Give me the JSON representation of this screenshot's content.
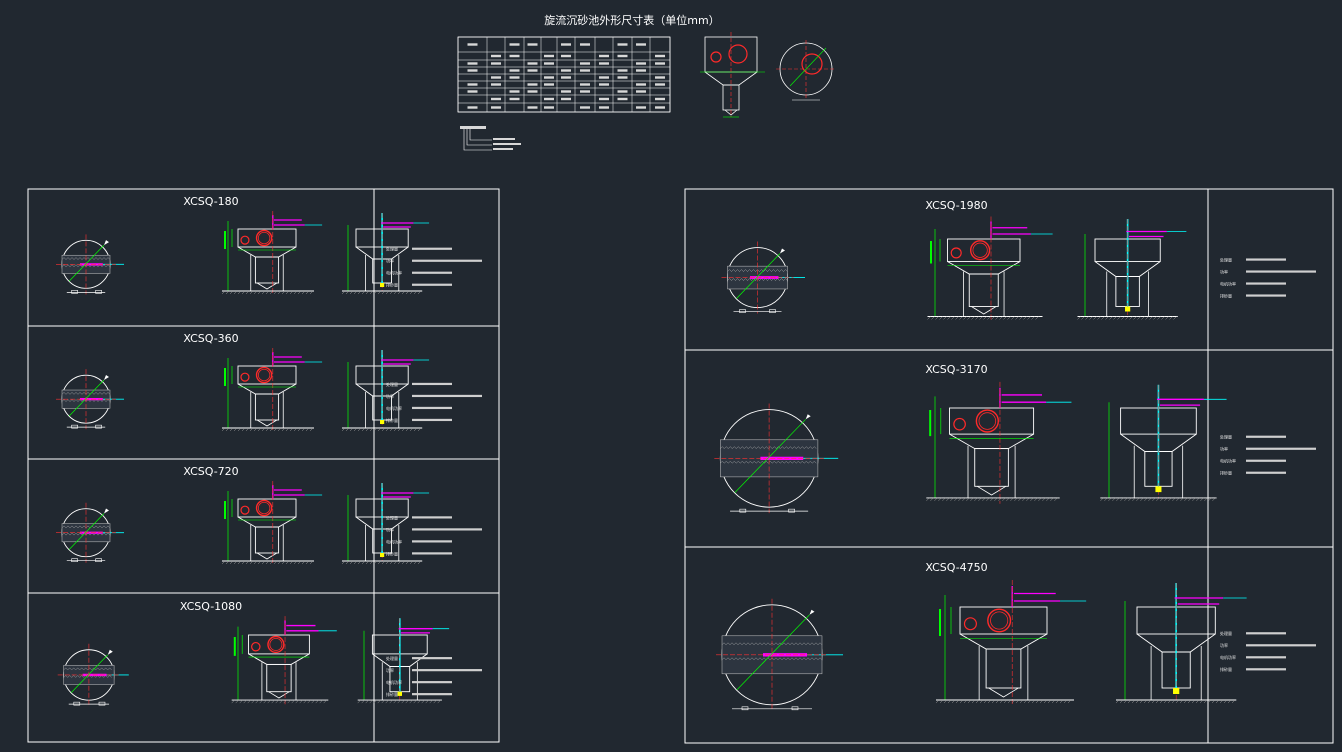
{
  "drawing": {
    "header_title": "旋流沉砂池外形尺寸表（单位mm）",
    "colors": {
      "background": "#212830",
      "frame": "#ffffff",
      "dimension": "#00ff00",
      "pipe": "#ff2a2a",
      "center": "#ff3030",
      "magenta": "#ff00ff",
      "cyan": "#00ffff",
      "yellow": "#ffff00"
    }
  },
  "panels": [
    {
      "id": "xcsq-180",
      "title": "XCSQ-180",
      "notes": [
        "处理量",
        "功率",
        "电机功率",
        "排砂量"
      ]
    },
    {
      "id": "xcsq-360",
      "title": "XCSQ-360",
      "notes": [
        "处理量",
        "功率",
        "电机功率",
        "排砂量"
      ]
    },
    {
      "id": "xcsq-720",
      "title": "XCSQ-720",
      "notes": [
        "处理量",
        "功率",
        "电机功率",
        "排砂量"
      ]
    },
    {
      "id": "xcsq-1080",
      "title": "XCSQ-1080",
      "notes": [
        "处理量",
        "功率",
        "电机功率",
        "排砂量"
      ]
    },
    {
      "id": "xcsq-1980",
      "title": "XCSQ-1980",
      "notes": [
        "处理量",
        "功率",
        "电机功率",
        "排砂量"
      ]
    },
    {
      "id": "xcsq-3170",
      "title": "XCSQ-3170",
      "notes": [
        "处理量",
        "功率",
        "电机功率",
        "排砂量"
      ]
    },
    {
      "id": "xcsq-4750",
      "title": "XCSQ-4750",
      "notes": [
        "处理量",
        "功率",
        "电机功率",
        "排砂量"
      ]
    }
  ]
}
